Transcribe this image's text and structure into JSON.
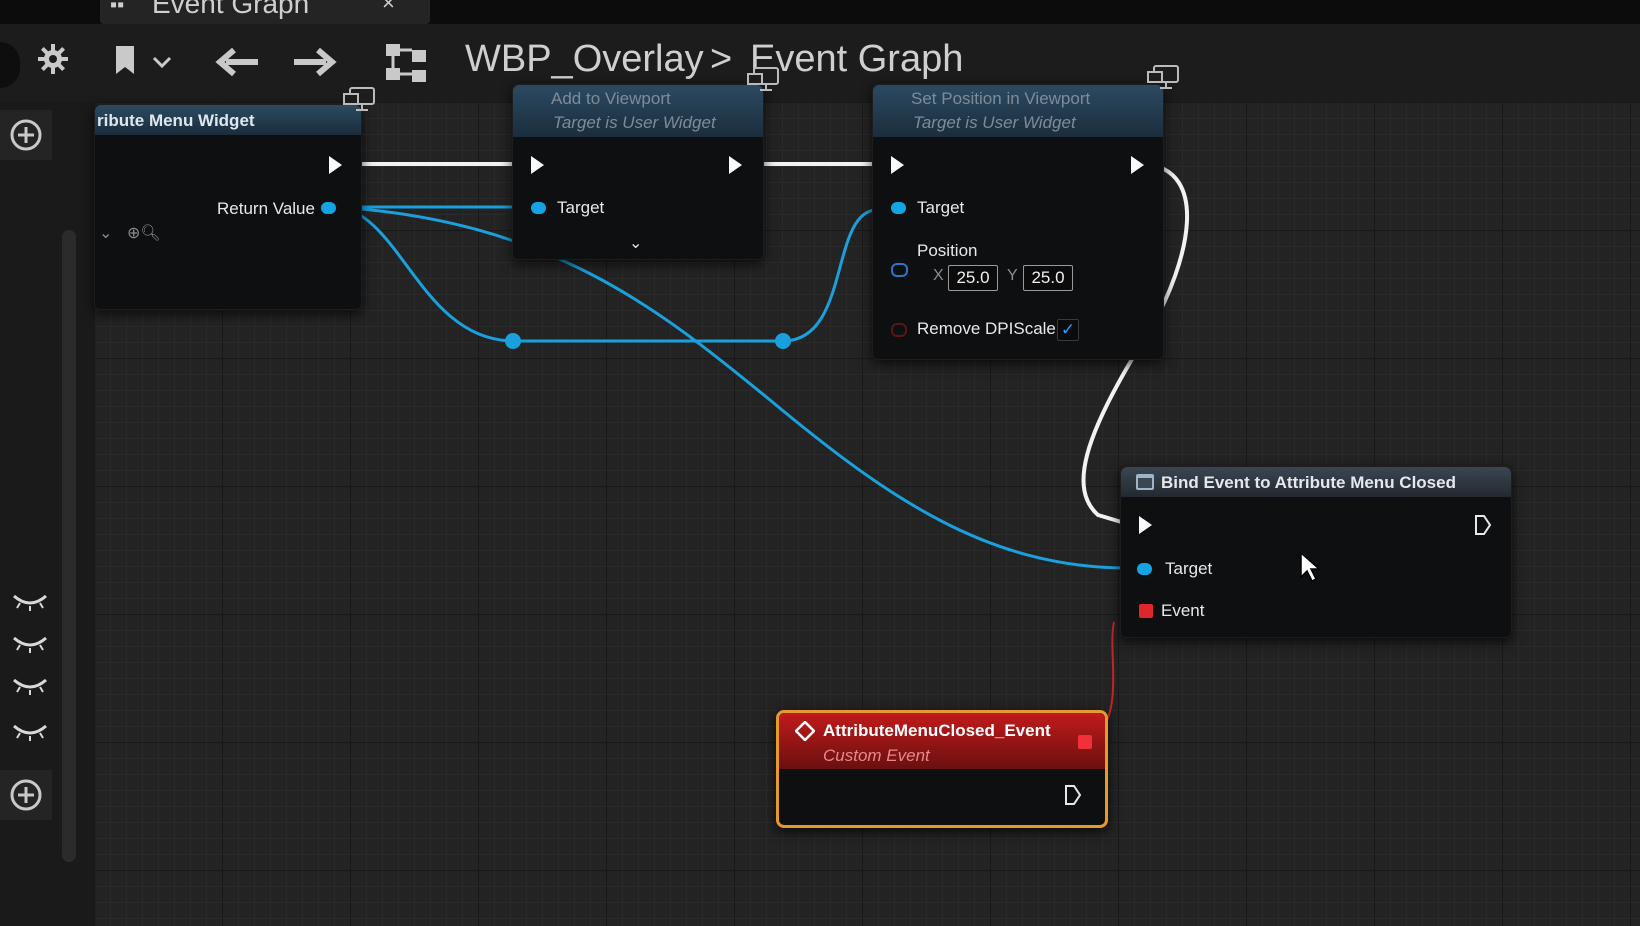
{
  "window": {
    "tab_label": "Event Graph",
    "tab_close": "×"
  },
  "toolbar": {
    "settings_icon": "gear-icon",
    "bookmark_icon": "bookmark-icon",
    "back_icon": "arrow-left-icon",
    "forward_icon": "arrow-right-icon",
    "hierarchy_icon": "graph-hierarchy-icon"
  },
  "breadcrumb": {
    "parent": "WBP_Overlay",
    "separator": ">",
    "current": "Event Graph"
  },
  "left_panel": {
    "add_icon": "plus-circle-icon",
    "eye_icon": "eye-closed-icon"
  },
  "nodes": {
    "create_widget": {
      "title": "ribute Menu Widget",
      "return_value": "Return Value"
    },
    "add_to_viewport": {
      "title": "Add to Viewport",
      "subtitle": "Target is User Widget",
      "target": "Target",
      "expand_icon": "chevron-down-icon"
    },
    "set_position": {
      "title": "Set Position in Viewport",
      "subtitle": "Target is User Widget",
      "target": "Target",
      "position": "Position",
      "x_label": "X",
      "x_value": "25.0",
      "y_label": "Y",
      "y_value": "25.0",
      "remove_dpi": "Remove DPIScale",
      "remove_dpi_checked": true
    },
    "bind_event": {
      "title": "Bind Event to Attribute Menu Closed",
      "target": "Target",
      "event": "Event"
    },
    "custom_event": {
      "title": "AttributeMenuClosed_Event",
      "subtitle": "Custom Event"
    }
  },
  "colors": {
    "exec_wire": "#f2f2f2",
    "object_wire": "#1aa0dc",
    "delegate_wire": "#c0252b",
    "selection_outline": "#e59a2b",
    "checkbox_check": "#2f9bff"
  }
}
